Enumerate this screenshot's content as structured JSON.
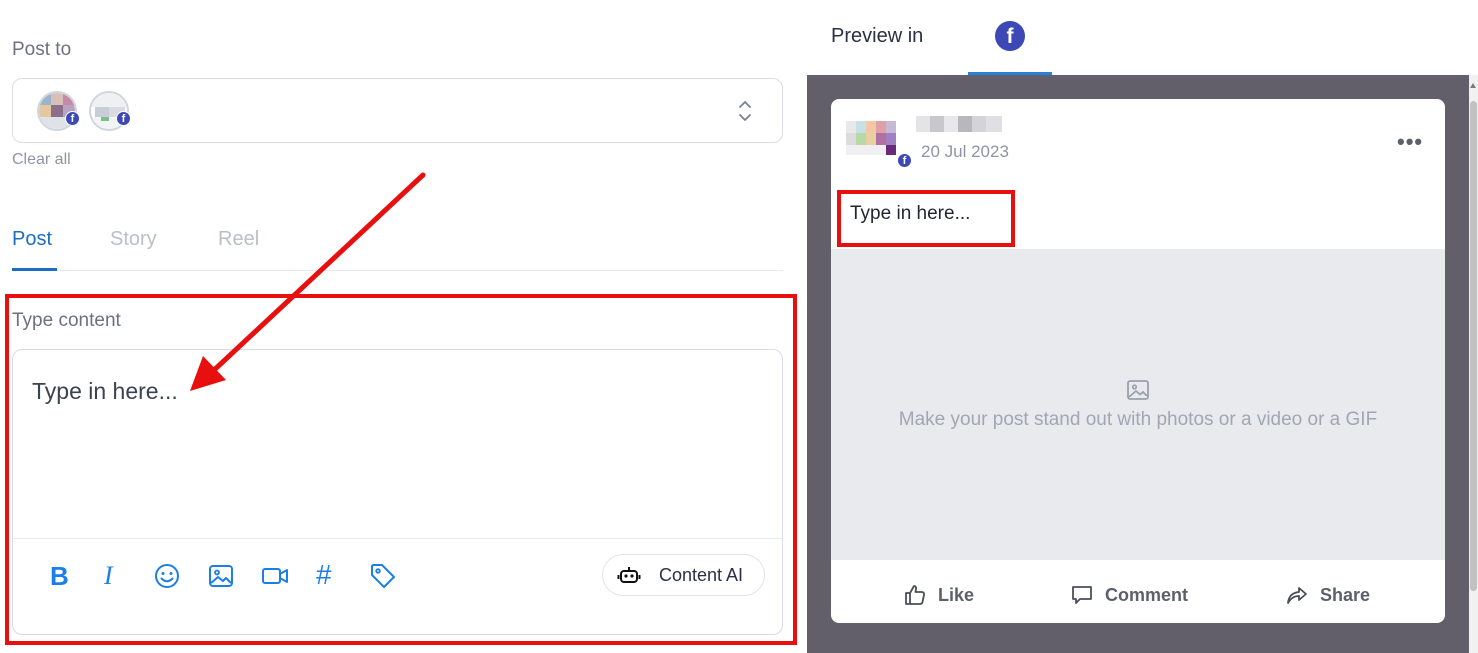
{
  "composer": {
    "post_to_label": "Post to",
    "clear_all_label": "Clear all",
    "tabs": [
      {
        "label": "Post",
        "active": true
      },
      {
        "label": "Story",
        "active": false
      },
      {
        "label": "Reel",
        "active": false
      }
    ],
    "content_label": "Type content",
    "editor_placeholder": "Type in here...",
    "toolbar": {
      "icons": [
        "bold-icon",
        "italic-icon",
        "emoji-icon",
        "image-icon",
        "video-icon",
        "hashtag-icon",
        "tag-icon"
      ],
      "content_ai_label": "Content AI"
    },
    "accounts": [
      {
        "network": "facebook",
        "badge": "f"
      },
      {
        "network": "facebook",
        "badge": "f"
      }
    ]
  },
  "preview": {
    "label": "Preview in",
    "network_badge": "f",
    "post": {
      "date": "20 Jul 2023",
      "text": "Type in here...",
      "media_prompt": "Make your post stand out with photos or a video or a GIF",
      "more": "•••",
      "badge": "f",
      "actions": {
        "like": "Like",
        "comment": "Comment",
        "share": "Share"
      }
    }
  },
  "colors": {
    "accent_blue": "#1b7fe6",
    "facebook_blue": "#3b48b5",
    "highlight_red": "#e8100f",
    "preview_background": "#625f6b"
  }
}
